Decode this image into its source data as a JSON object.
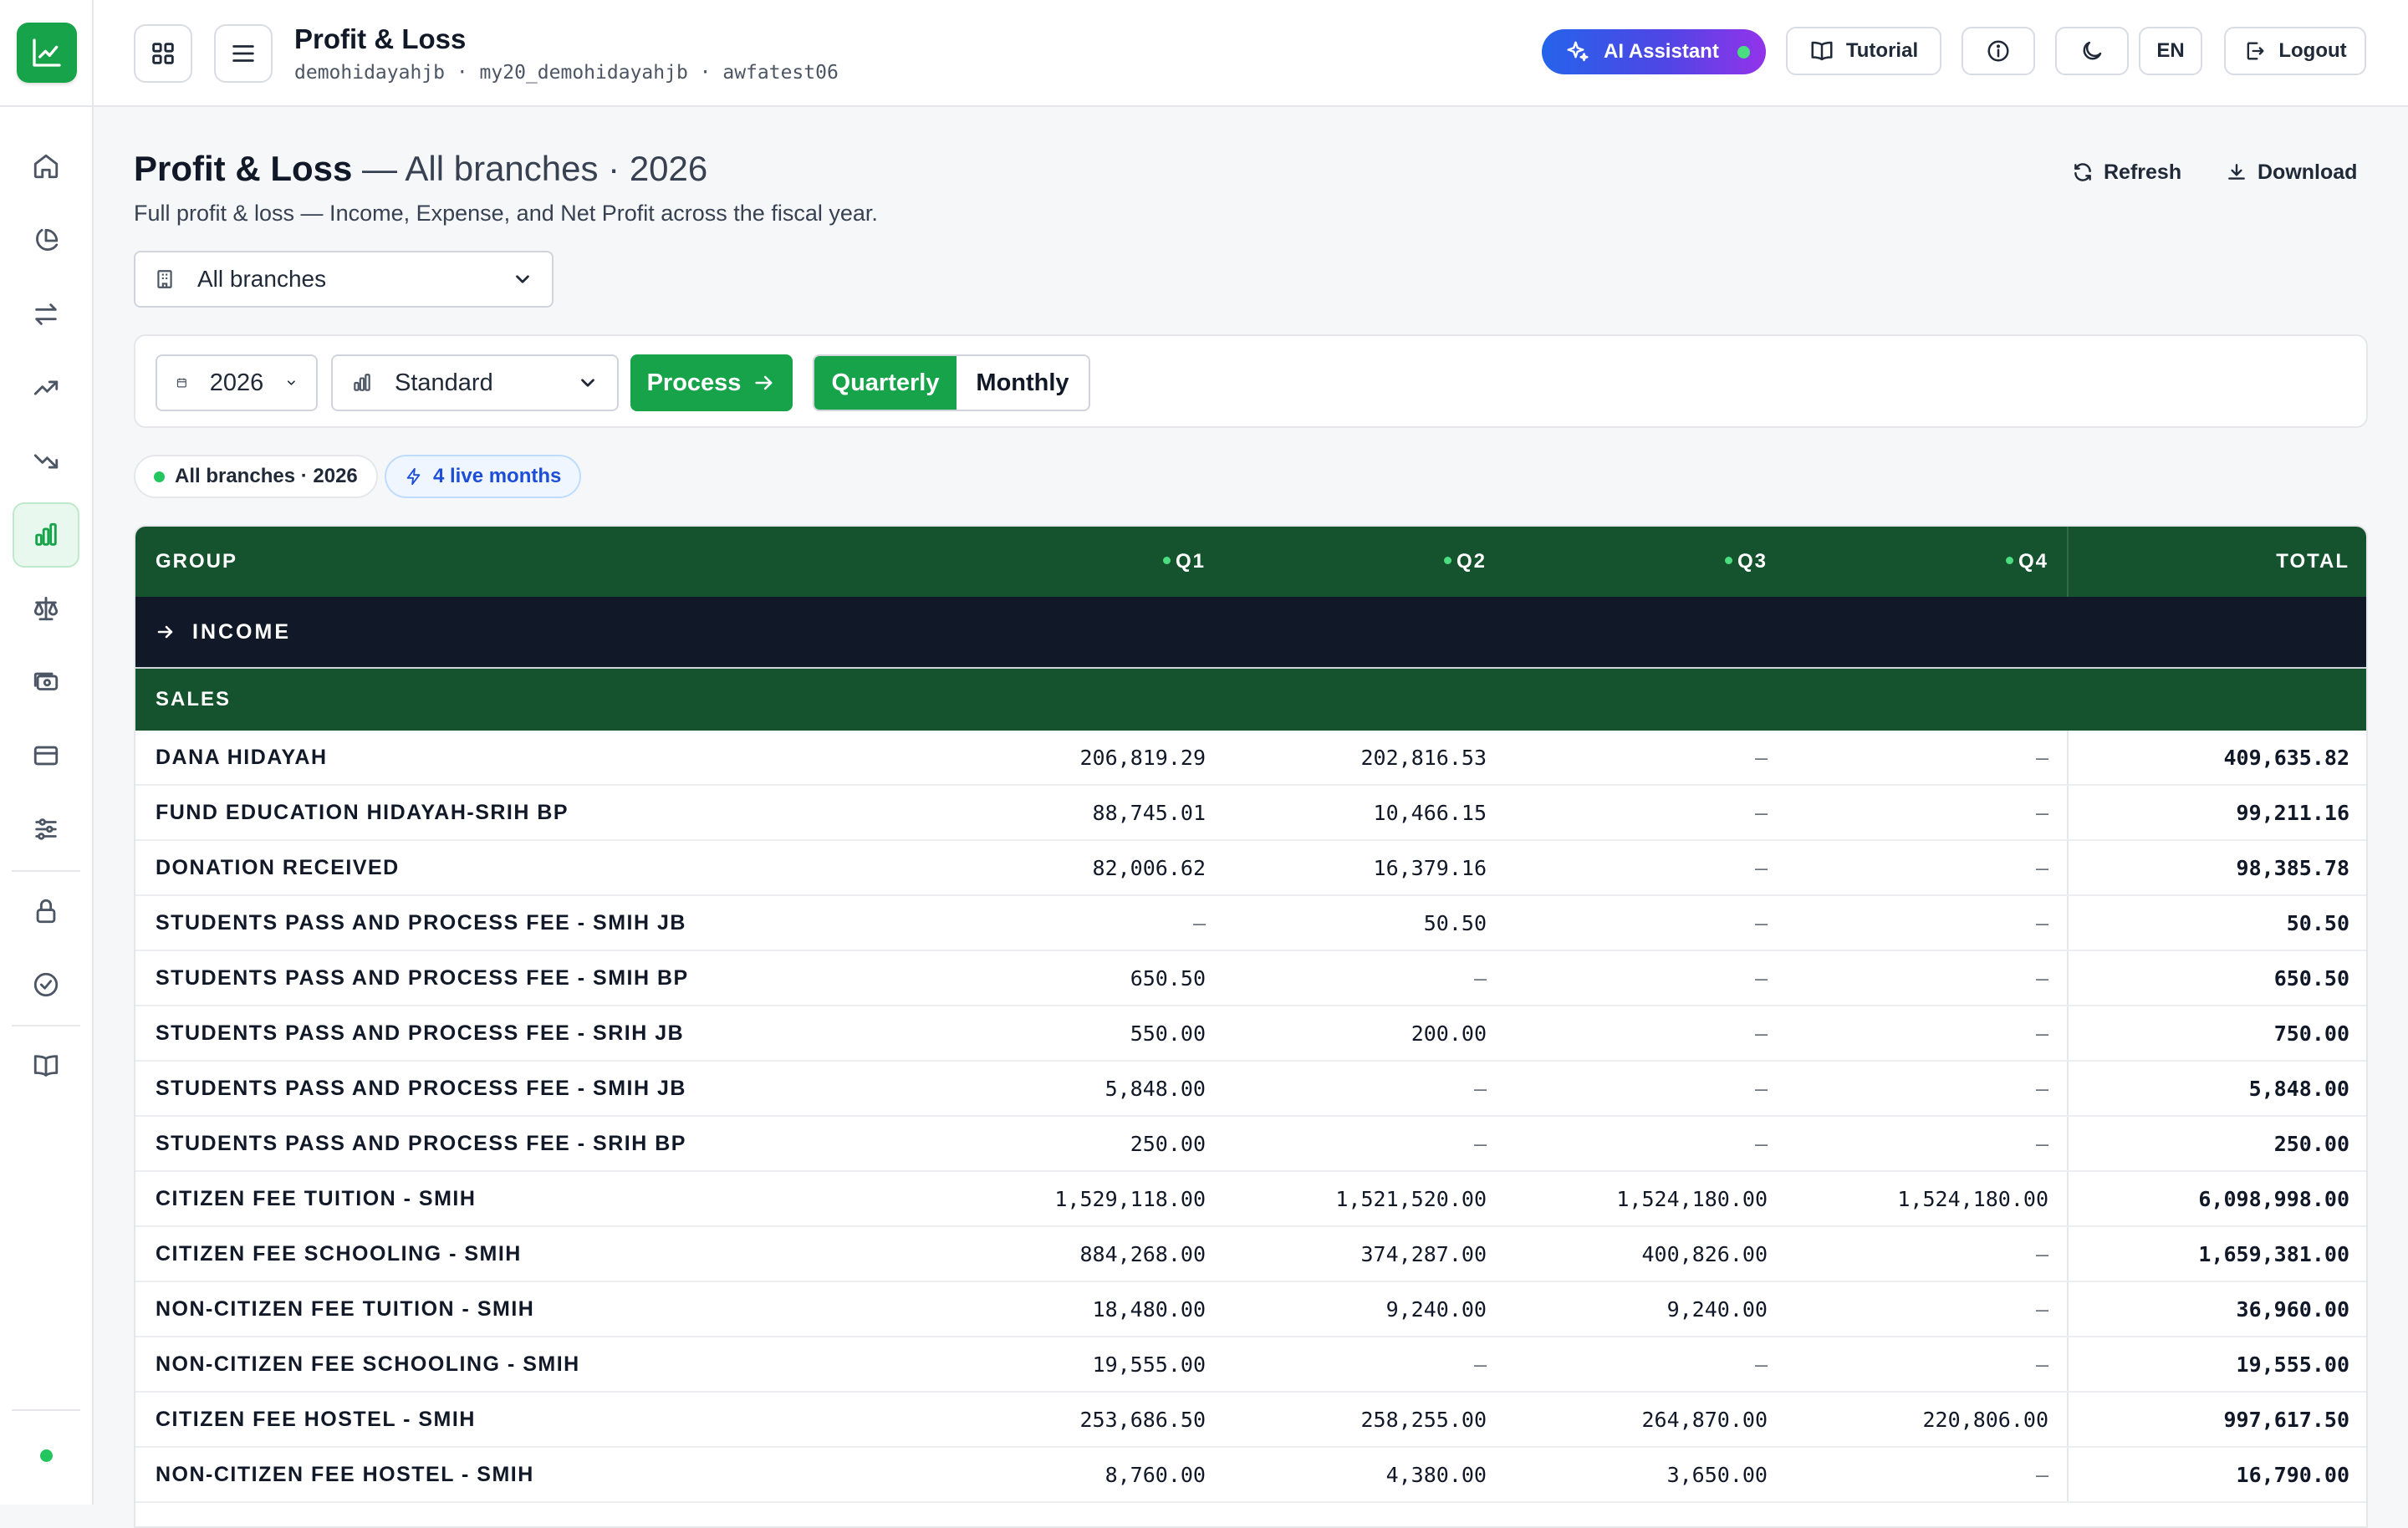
{
  "header": {
    "title": "Profit & Loss",
    "breadcrumb": "demohidayahjb · my20_demohidayahjb · awfatest06",
    "ai_label": "AI Assistant",
    "tutorial_label": "Tutorial",
    "lang_label": "EN",
    "logout_label": "Logout"
  },
  "rail": {
    "icons": [
      "home-icon",
      "pie-chart-icon",
      "transfer-icon",
      "trending-up-icon",
      "trending-down-icon",
      "bar-chart-icon",
      "scale-icon",
      "cash-icon",
      "card-icon",
      "sliders-icon",
      "lock-icon",
      "check-circle-icon",
      "book-icon"
    ],
    "active": "bar-chart-icon"
  },
  "page": {
    "title_bold": "Profit & Loss",
    "title_rest": " — All branches · 2026",
    "description": "Full profit & loss — Income, Expense, and Net Profit across the fiscal year.",
    "refresh_label": "Refresh",
    "download_label": "Download",
    "branch_select": "All branches"
  },
  "toolbar": {
    "year": "2026",
    "report_type": "Standard",
    "process_label": "Process",
    "quarterly_label": "Quarterly",
    "monthly_label": "Monthly",
    "active_period": "Quarterly"
  },
  "chips": {
    "branch_chip": "All branches · 2026",
    "live_chip": "4 live months"
  },
  "table": {
    "columns": {
      "group": "GROUP",
      "q1": "Q1",
      "q2": "Q2",
      "q3": "Q3",
      "q4": "Q4",
      "total": "TOTAL"
    },
    "section": "INCOME",
    "subgroup": "SALES",
    "rows": [
      {
        "name": "DANA HIDAYAH",
        "q1": "206,819.29",
        "q2": "202,816.53",
        "q3": "–",
        "q4": "–",
        "total": "409,635.82"
      },
      {
        "name": "FUND EDUCATION HIDAYAH-SRIH BP",
        "q1": "88,745.01",
        "q2": "10,466.15",
        "q3": "–",
        "q4": "–",
        "total": "99,211.16"
      },
      {
        "name": "DONATION RECEIVED",
        "q1": "82,006.62",
        "q2": "16,379.16",
        "q3": "–",
        "q4": "–",
        "total": "98,385.78"
      },
      {
        "name": "STUDENTS PASS AND PROCESS FEE - SMIH JB",
        "q1": "–",
        "q2": "50.50",
        "q3": "–",
        "q4": "–",
        "total": "50.50"
      },
      {
        "name": "STUDENTS PASS AND PROCESS FEE - SMIH BP",
        "q1": "650.50",
        "q2": "–",
        "q3": "–",
        "q4": "–",
        "total": "650.50"
      },
      {
        "name": "STUDENTS PASS AND PROCESS FEE - SRIH JB",
        "q1": "550.00",
        "q2": "200.00",
        "q3": "–",
        "q4": "–",
        "total": "750.00"
      },
      {
        "name": "STUDENTS PASS AND PROCESS FEE - SMIH JB",
        "q1": "5,848.00",
        "q2": "–",
        "q3": "–",
        "q4": "–",
        "total": "5,848.00"
      },
      {
        "name": "STUDENTS PASS AND PROCESS FEE - SRIH BP",
        "q1": "250.00",
        "q2": "–",
        "q3": "–",
        "q4": "–",
        "total": "250.00"
      },
      {
        "name": "CITIZEN FEE TUITION - SMIH",
        "q1": "1,529,118.00",
        "q2": "1,521,520.00",
        "q3": "1,524,180.00",
        "q4": "1,524,180.00",
        "total": "6,098,998.00"
      },
      {
        "name": "CITIZEN FEE SCHOOLING - SMIH",
        "q1": "884,268.00",
        "q2": "374,287.00",
        "q3": "400,826.00",
        "q4": "–",
        "total": "1,659,381.00"
      },
      {
        "name": "NON-CITIZEN FEE TUITION - SMIH",
        "q1": "18,480.00",
        "q2": "9,240.00",
        "q3": "9,240.00",
        "q4": "–",
        "total": "36,960.00"
      },
      {
        "name": "NON-CITIZEN FEE SCHOOLING - SMIH",
        "q1": "19,555.00",
        "q2": "–",
        "q3": "–",
        "q4": "–",
        "total": "19,555.00"
      },
      {
        "name": "CITIZEN FEE HOSTEL - SMIH",
        "q1": "253,686.50",
        "q2": "258,255.00",
        "q3": "264,870.00",
        "q4": "220,806.00",
        "total": "997,617.50"
      },
      {
        "name": "NON-CITIZEN FEE HOSTEL - SMIH",
        "q1": "8,760.00",
        "q2": "4,380.00",
        "q3": "3,650.00",
        "q4": "–",
        "total": "16,790.00"
      }
    ]
  },
  "colors": {
    "brand_green": "#16a34a",
    "header_green": "#14532d",
    "section_dark": "#111827",
    "ai_gradient_start": "#2563eb",
    "ai_gradient_end": "#9333ea"
  }
}
